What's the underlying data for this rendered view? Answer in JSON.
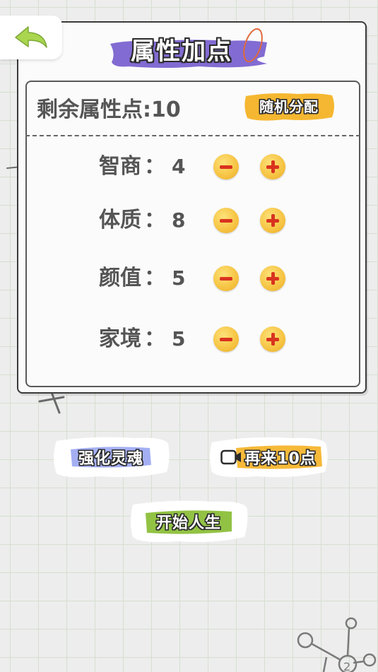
{
  "header": {
    "back_icon": "back-arrow-icon",
    "title": "属性加点"
  },
  "points": {
    "remaining_label": "剩余属性点:",
    "remaining_value": "10",
    "random_button": "随机分配"
  },
  "attributes": [
    {
      "name": "智商",
      "value": "4"
    },
    {
      "name": "体质",
      "value": "8"
    },
    {
      "name": "颜值",
      "value": "5"
    },
    {
      "name": "家境",
      "value": "5"
    }
  ],
  "colon": "：",
  "actions": {
    "enhance_soul": "强化灵魂",
    "ten_more": "再来10点",
    "start_life": "开始人生"
  },
  "colors": {
    "title_highlight": "#7b63d0",
    "random_highlight": "#f5b731",
    "enhance_highlight": "#9aa6f2",
    "ten_more_highlight": "#f6b52e",
    "start_highlight": "#8cbf3a",
    "coin": "#f6c341",
    "coin_sign": "#d9331f",
    "back_arrow": "#a9d64e"
  }
}
